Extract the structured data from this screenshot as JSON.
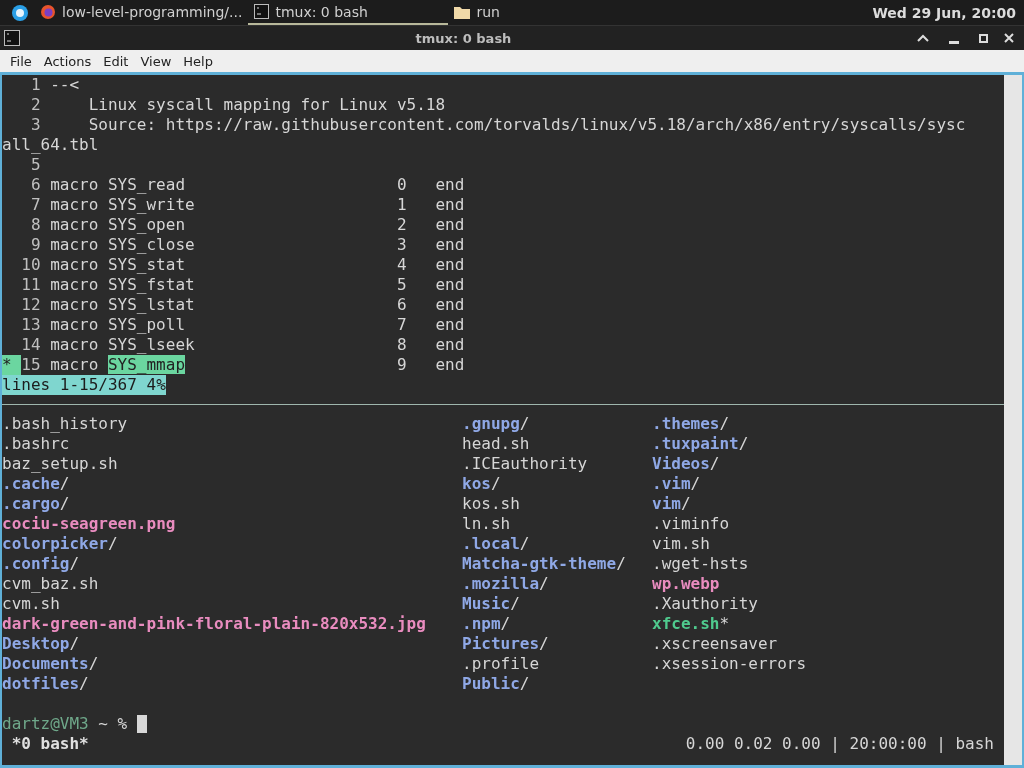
{
  "panel": {
    "tasks": [
      {
        "kind": "browser",
        "label": "low-level-programming/...",
        "selected": false
      },
      {
        "kind": "terminal",
        "label": "tmux: 0 bash",
        "selected": true
      },
      {
        "kind": "folder",
        "label": "run",
        "selected": false
      }
    ],
    "clock": "Wed 29 Jun, 20:00"
  },
  "window": {
    "title": "tmux: 0 bash"
  },
  "menu": [
    "File",
    "Actions",
    "Edit",
    "View",
    "Help"
  ],
  "editor": {
    "lines": [
      {
        "num": "1",
        "text": "--<"
      },
      {
        "num": "2",
        "text": "    Linux syscall mapping for Linux v5.18"
      },
      {
        "num": "3",
        "text": "    Source: https://raw.githubusercontent.com/torvalds/linux/v5.18/arch/x86/entry/syscalls/sysc"
      },
      {
        "continuation": "all_64.tbl"
      },
      {
        "num": "5"
      },
      {
        "num": "6",
        "text": "macro SYS_read                      0   end"
      },
      {
        "num": "7",
        "text": "macro SYS_write                     1   end"
      },
      {
        "num": "8",
        "text": "macro SYS_open                      2   end"
      },
      {
        "num": "9",
        "text": "macro SYS_close                     3   end"
      },
      {
        "num": "10",
        "text": "macro SYS_stat                      4   end"
      },
      {
        "num": "11",
        "text": "macro SYS_fstat                     5   end"
      },
      {
        "num": "12",
        "text": "macro SYS_lstat                     6   end"
      },
      {
        "num": "13",
        "text": "macro SYS_poll                      7   end"
      },
      {
        "num": "14",
        "text": "macro SYS_lseek                     8   end"
      },
      {
        "num": "15",
        "sign": "*",
        "text": "macro ",
        "match": "SYS_mmap",
        "rest": "                      9   end"
      }
    ],
    "status": "lines 1-15/367 4%"
  },
  "listing": [
    [
      {
        "name": ".bash_history",
        "kind": "file"
      },
      {
        "name": ".bashrc",
        "kind": "file"
      },
      {
        "name": "baz_setup.sh",
        "kind": "file"
      },
      {
        "name": ".cache",
        "suffix": "/",
        "kind": "dir"
      },
      {
        "name": ".cargo",
        "suffix": "/",
        "kind": "dir"
      },
      {
        "name": "cociu-seagreen.png",
        "kind": "image"
      },
      {
        "name": "colorpicker",
        "suffix": "/",
        "kind": "dir"
      },
      {
        "name": ".config",
        "suffix": "/",
        "kind": "dir"
      },
      {
        "name": "cvm_baz.sh",
        "kind": "file"
      },
      {
        "name": "cvm.sh",
        "kind": "file"
      },
      {
        "name": "dark-green-and-pink-floral-plain-820x532.jpg",
        "kind": "image"
      },
      {
        "name": "Desktop",
        "suffix": "/",
        "kind": "dir"
      },
      {
        "name": "Documents",
        "suffix": "/",
        "kind": "dir"
      },
      {
        "name": "dotfiles",
        "suffix": "/",
        "kind": "dir"
      }
    ],
    [
      {
        "name": ".gnupg",
        "suffix": "/",
        "kind": "dir"
      },
      {
        "name": "head.sh",
        "kind": "file"
      },
      {
        "name": ".ICEauthority",
        "kind": "file"
      },
      {
        "name": "kos",
        "suffix": "/",
        "kind": "dir"
      },
      {
        "name": "kos.sh",
        "kind": "file"
      },
      {
        "name": "ln.sh",
        "kind": "file"
      },
      {
        "name": ".local",
        "suffix": "/",
        "kind": "dir"
      },
      {
        "name": "Matcha-gtk-theme",
        "suffix": "/",
        "kind": "dir"
      },
      {
        "name": ".mozilla",
        "suffix": "/",
        "kind": "dir"
      },
      {
        "name": "Music",
        "suffix": "/",
        "kind": "dir"
      },
      {
        "name": ".npm",
        "suffix": "/",
        "kind": "dir"
      },
      {
        "name": "Pictures",
        "suffix": "/",
        "kind": "dir"
      },
      {
        "name": ".profile",
        "kind": "file"
      },
      {
        "name": "Public",
        "suffix": "/",
        "kind": "dir"
      }
    ],
    [
      {
        "name": ".themes",
        "suffix": "/",
        "kind": "dir"
      },
      {
        "name": ".tuxpaint",
        "suffix": "/",
        "kind": "dir"
      },
      {
        "name": "Videos",
        "suffix": "/",
        "kind": "dir"
      },
      {
        "name": ".vim",
        "suffix": "/",
        "kind": "dir"
      },
      {
        "name": "vim",
        "suffix": "/",
        "kind": "dir"
      },
      {
        "name": ".viminfo",
        "kind": "file"
      },
      {
        "name": "vim.sh",
        "kind": "file"
      },
      {
        "name": ".wget-hsts",
        "kind": "file"
      },
      {
        "name": "wp.webp",
        "kind": "image"
      },
      {
        "name": ".Xauthority",
        "kind": "file"
      },
      {
        "name": "xfce.sh",
        "suffix": "*",
        "kind": "exec"
      },
      {
        "name": ".xscreensaver",
        "kind": "file"
      },
      {
        "name": ".xsession-errors",
        "kind": "file"
      }
    ]
  ],
  "prompt": {
    "user": "dartz@VM3",
    "rest": " ~ % "
  },
  "tmux": {
    "window": " *0 bash*",
    "right": "0.00 0.02 0.00 | 20:00:00 | bash"
  }
}
